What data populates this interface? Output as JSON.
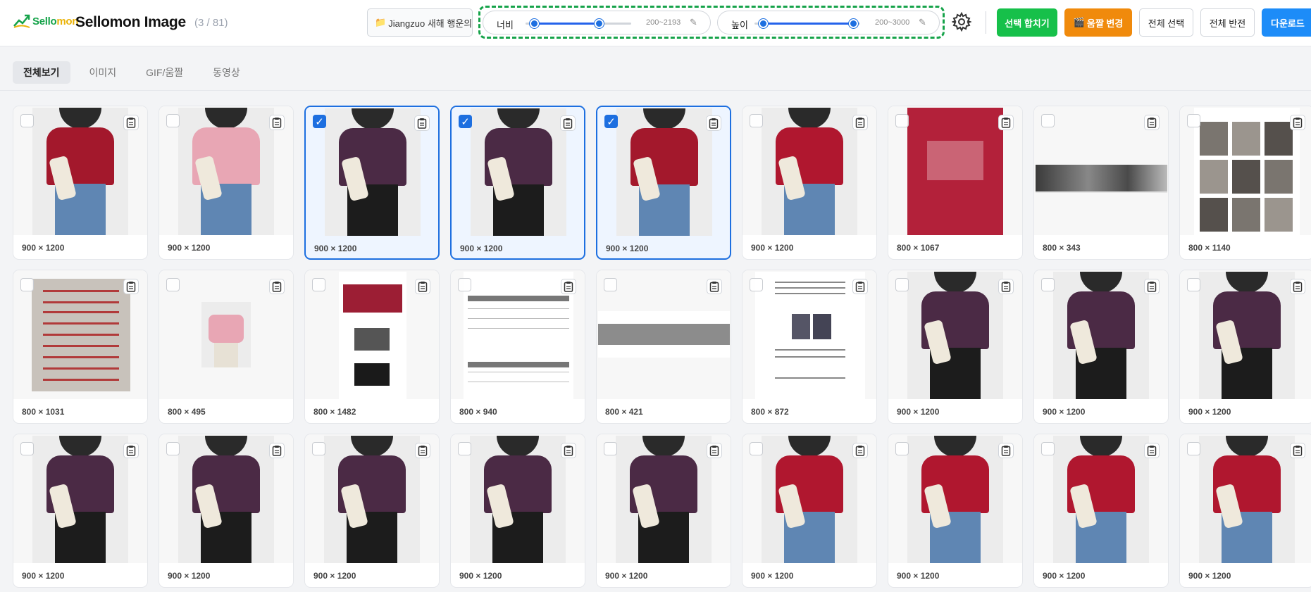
{
  "header": {
    "logo_word_a": "Sello",
    "logo_word_b": "mon",
    "title": "Sellomon Image",
    "count": "(3 / 81)",
    "folder_label": "Jiangzuo 새해 행운의",
    "width_slider": {
      "label": "너비",
      "range_text": "200~2193",
      "min": 200,
      "max": 2193,
      "low": 200,
      "high": 2193
    },
    "height_slider": {
      "label": "높이",
      "range_text": "200~3000",
      "min": 200,
      "max": 3000,
      "low": 200,
      "high": 3000
    },
    "buttons": {
      "merge": "선택 합치기",
      "convert": "움짤 변경",
      "select_all": "전체 선택",
      "invert": "전체 반전",
      "download": "다운로드"
    }
  },
  "tabs": [
    "전체보기",
    "이미지",
    "GIF/움짤",
    "동영상"
  ],
  "active_tab": 0,
  "images": [
    {
      "dims": "900 × 1200",
      "kind": "photo",
      "color": "#a3182c",
      "selected": false
    },
    {
      "dims": "900 × 1200",
      "kind": "photo",
      "color": "#e8a6b4",
      "selected": false
    },
    {
      "dims": "900 × 1200",
      "kind": "photo",
      "color": "#4b2a45",
      "selected": true
    },
    {
      "dims": "900 × 1200",
      "kind": "photo",
      "color": "#4b2a45",
      "selected": true
    },
    {
      "dims": "900 × 1200",
      "kind": "photo",
      "color": "#a3182c",
      "selected": true
    },
    {
      "dims": "900 × 1200",
      "kind": "photo",
      "color": "#b0172f",
      "selected": false
    },
    {
      "dims": "800 × 1067",
      "kind": "swatch",
      "color": "#b3213a",
      "selected": false
    },
    {
      "dims": "800 × 343",
      "kind": "banner",
      "color": "#3a3a3a",
      "selected": false
    },
    {
      "dims": "800 × 1140",
      "kind": "collage",
      "color": "#8a8580",
      "selected": false
    },
    {
      "dims": "800 × 1031",
      "kind": "doc-red",
      "color": "#c8c2bb",
      "selected": false
    },
    {
      "dims": "800 × 495",
      "kind": "small-photo",
      "color": "#e8a6b4",
      "selected": false
    },
    {
      "dims": "800 × 1482",
      "kind": "doc-long",
      "color": "#9c1e34",
      "selected": false
    },
    {
      "dims": "800 × 940",
      "kind": "doc-table",
      "color": "#777777",
      "selected": false
    },
    {
      "dims": "800 × 421",
      "kind": "gray-banner",
      "color": "#8c8c8c",
      "selected": false
    },
    {
      "dims": "800 × 872",
      "kind": "doc-text",
      "color": "#4a4a4a",
      "selected": false
    },
    {
      "dims": "900 × 1200",
      "kind": "photo",
      "color": "#4b2a45",
      "selected": false
    },
    {
      "dims": "900 × 1200",
      "kind": "photo",
      "color": "#4b2a45",
      "selected": false
    },
    {
      "dims": "900 × 1200",
      "kind": "photo",
      "color": "#4b2a45",
      "selected": false
    },
    {
      "dims": "900 × 1200",
      "kind": "photo",
      "color": "#4b2a45",
      "selected": false
    },
    {
      "dims": "900 × 1200",
      "kind": "photo",
      "color": "#4b2a45",
      "selected": false
    },
    {
      "dims": "900 × 1200",
      "kind": "photo",
      "color": "#4b2a45",
      "selected": false
    },
    {
      "dims": "900 × 1200",
      "kind": "photo",
      "color": "#4b2a45",
      "selected": false
    },
    {
      "dims": "900 × 1200",
      "kind": "photo",
      "color": "#4b2a45",
      "selected": false
    },
    {
      "dims": "900 × 1200",
      "kind": "photo",
      "color": "#b0172f",
      "selected": false
    },
    {
      "dims": "900 × 1200",
      "kind": "photo",
      "color": "#b0172f",
      "selected": false
    },
    {
      "dims": "900 × 1200",
      "kind": "photo",
      "color": "#b0172f",
      "selected": false
    },
    {
      "dims": "900 × 1200",
      "kind": "photo",
      "color": "#b0172f",
      "selected": false
    }
  ],
  "colors": {
    "accent": "#1d6fe0",
    "green": "#16c04a",
    "orange": "#f08a0c",
    "blue": "#1d8cf8",
    "dashed_border": "#16a34a"
  },
  "icons": {
    "folder": "folder-icon",
    "gear": "gear-icon",
    "clipboard": "clipboard-icon",
    "pencil": "pencil-icon",
    "film": "film-icon"
  }
}
